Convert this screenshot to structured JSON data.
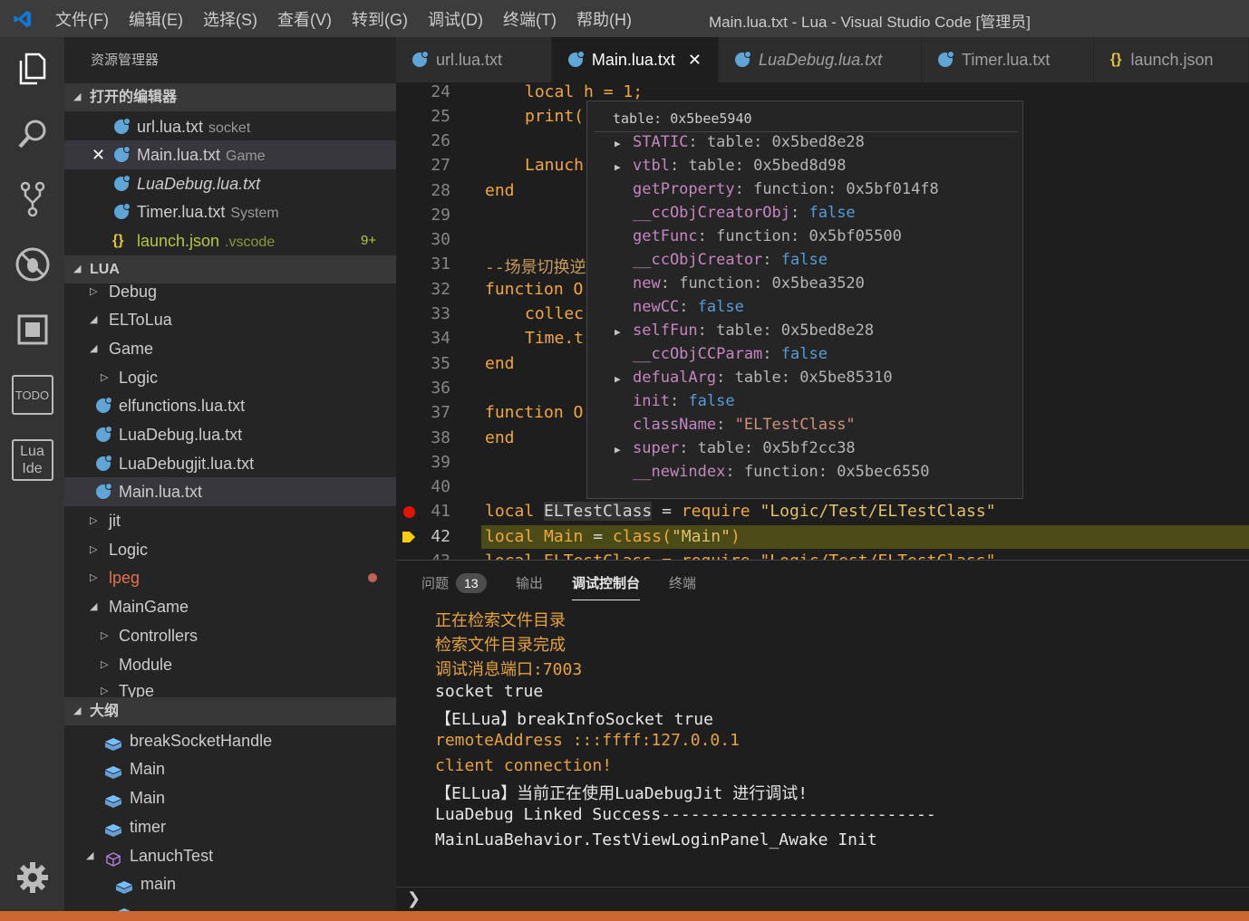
{
  "titlebar": {
    "menus": [
      "文件(F)",
      "编辑(E)",
      "选择(S)",
      "查看(V)",
      "转到(G)",
      "调试(D)",
      "终端(T)",
      "帮助(H)"
    ],
    "title": "Main.lua.txt - Lua - Visual Studio Code [管理员]"
  },
  "activitybar": {
    "icons": [
      "explorer-icon",
      "search-icon",
      "source-control-icon",
      "debug-icon",
      "extensions-icon",
      "todo-icon",
      "lua-ide-icon",
      "settings-gear-icon"
    ],
    "todo_label": "TODO",
    "lua_label_1": "Lua",
    "lua_label_2": "Ide"
  },
  "sidebar": {
    "title": "资源管理器",
    "open_editors_header": "打开的编辑器",
    "open_editors": [
      {
        "name": "url.lua.txt",
        "desc": "socket"
      },
      {
        "name": "Main.lua.txt",
        "desc": "Game"
      },
      {
        "name": "LuaDebug.lua.txt",
        "desc": ""
      },
      {
        "name": "Timer.lua.txt",
        "desc": "System"
      },
      {
        "name": "launch.json",
        "desc": ".vscode",
        "count": "9+"
      }
    ],
    "lua_header": "LUA",
    "tree": [
      {
        "name": "Debug"
      },
      {
        "name": "ELToLua"
      },
      {
        "name": "Game"
      },
      {
        "name": "Logic"
      },
      {
        "name": "elfunctions.lua.txt"
      },
      {
        "name": "LuaDebug.lua.txt"
      },
      {
        "name": "LuaDebugjit.lua.txt"
      },
      {
        "name": "Main.lua.txt"
      },
      {
        "name": "jit"
      },
      {
        "name": "Logic"
      },
      {
        "name": "lpeg"
      },
      {
        "name": "MainGame"
      },
      {
        "name": "Controllers"
      },
      {
        "name": "Module"
      },
      {
        "name": "Type"
      }
    ],
    "outline_header": "大纲",
    "outline": [
      {
        "name": "breakSocketHandle"
      },
      {
        "name": "Main"
      },
      {
        "name": "Main"
      },
      {
        "name": "timer"
      },
      {
        "name": "LanuchTest"
      },
      {
        "name": "main"
      }
    ]
  },
  "tabs": [
    {
      "label": "url.lua.txt"
    },
    {
      "label": "Main.lua.txt"
    },
    {
      "label": "LuaDebug.lua.txt"
    },
    {
      "label": "Timer.lua.txt"
    },
    {
      "label": "launch.json"
    }
  ],
  "editor": {
    "line_numbers": [
      "24",
      "25",
      "26",
      "27",
      "28",
      "29",
      "30",
      "31",
      "32",
      "33",
      "34",
      "35",
      "36",
      "37",
      "38",
      "39",
      "40",
      "41",
      "42",
      "43"
    ],
    "lines": {
      "l24": [
        "local h = 1;"
      ],
      "l25": [
        "print("
      ],
      "l27": [
        "Lanuch"
      ],
      "l28": [
        "end"
      ],
      "l31": [
        "--场景切换逆"
      ],
      "l32": [
        "function O"
      ],
      "l33": [
        "collec"
      ],
      "l34": [
        "Time.t"
      ],
      "l35": [
        "end"
      ],
      "l37": [
        "function O"
      ],
      "l38": [
        "end"
      ],
      "l41_kw": "local",
      "l41_name": "ELTestClass",
      "l41_op": "=",
      "l41_req": "require",
      "l41_str": "\"Logic/Test/ELTestClass\"",
      "l42_kw": "local",
      "l42_name": "Main",
      "l42_op": "=",
      "l42_fn": "class(",
      "l42_str": "\"Main\"",
      "l42_close": ")",
      "l43": "local ELTestClass = require \"Logic/Test/ELTestClass\""
    }
  },
  "hover": {
    "header": "table: 0x5bee5940",
    "items": [
      {
        "key": "STATIC",
        "value": "table: 0x5bed8e28",
        "expandable": true,
        "kind": "plain"
      },
      {
        "key": "vtbl",
        "value": "table: 0x5bed8d98",
        "expandable": true,
        "kind": "plain"
      },
      {
        "key": "getProperty",
        "value": "function: 0x5bf014f8",
        "expandable": false,
        "kind": "plain"
      },
      {
        "key": "__ccObjCreatorObj",
        "value": "false",
        "expandable": false,
        "kind": "bool"
      },
      {
        "key": "getFunc",
        "value": "function: 0x5bf05500",
        "expandable": false,
        "kind": "plain"
      },
      {
        "key": "__ccObjCreator",
        "value": "false",
        "expandable": false,
        "kind": "bool"
      },
      {
        "key": "new",
        "value": "function: 0x5bea3520",
        "expandable": false,
        "kind": "plain"
      },
      {
        "key": "newCC",
        "value": "false",
        "expandable": false,
        "kind": "bool"
      },
      {
        "key": "selfFun",
        "value": "table: 0x5bed8e28",
        "expandable": true,
        "kind": "plain"
      },
      {
        "key": "__ccObjCCParam",
        "value": "false",
        "expandable": false,
        "kind": "bool"
      },
      {
        "key": "defualArg",
        "value": "table: 0x5be85310",
        "expandable": true,
        "kind": "plain"
      },
      {
        "key": "init",
        "value": "false",
        "expandable": false,
        "kind": "bool"
      },
      {
        "key": "className",
        "value": "\"ELTestClass\"",
        "expandable": false,
        "kind": "str"
      },
      {
        "key": "super",
        "value": "table: 0x5bf2cc38",
        "expandable": true,
        "kind": "plain"
      },
      {
        "key": "__newindex",
        "value": "function: 0x5bec6550",
        "expandable": false,
        "kind": "plain"
      }
    ]
  },
  "panel": {
    "tabs": {
      "problems": "问题",
      "problems_count": "13",
      "output": "输出",
      "debug_console": "调试控制台",
      "terminal": "终端"
    },
    "output": [
      {
        "text": "正在检索文件目录",
        "color": "orange"
      },
      {
        "text": "检索文件目录完成",
        "color": "orange"
      },
      {
        "text": "调试消息端口:7003",
        "color": "orange"
      },
      {
        "text": "socket true",
        "color": "white"
      },
      {
        "text": "【ELLua】breakInfoSocket true",
        "color": "white"
      },
      {
        "text": "remoteAddress :::ffff:127.0.0.1",
        "color": "orange"
      },
      {
        "text": "client connection!",
        "color": "orange"
      },
      {
        "text": "【ELLua】当前正在使用LuaDebugJit 进行调试!",
        "color": "white"
      },
      {
        "text": "LuaDebug Linked Success----------------------------",
        "color": "white"
      },
      {
        "text": "MainLuaBehavior.TestViewLoginPanel_Awake Init",
        "color": "white"
      }
    ],
    "prompt": "❯"
  },
  "colors": {
    "accent_status": "#cc6633",
    "keyword": "#f0a83a",
    "string": "#e0c068",
    "breakpoint": "#e51400"
  }
}
